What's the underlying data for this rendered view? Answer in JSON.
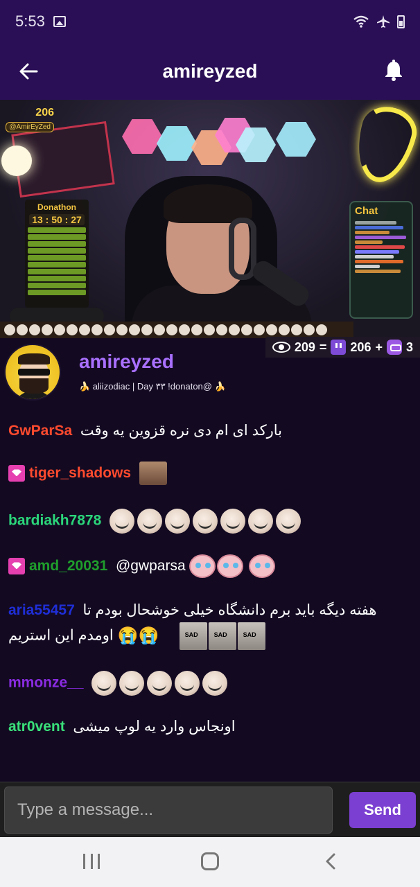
{
  "status_bar": {
    "time": "5:53"
  },
  "app_bar": {
    "title": "amireyzed"
  },
  "stream": {
    "overlay_count": "206",
    "overlay_handle": "@AmirEyZed",
    "donathon_title": "Donathon",
    "donathon_timer": "13 : 50 : 27",
    "chat_panel_title": "Chat"
  },
  "viewer_stats": {
    "views": "209",
    "eq": "=",
    "twitch": "206",
    "plus": "+",
    "kick": "3"
  },
  "profile": {
    "name": "amireyzed",
    "status": "🍌 aliizodiac | Day ۳۳ !donaton@ 🍌"
  },
  "chat": {
    "messages": [
      {
        "user": "GwParSa",
        "color": "#ff4a2e",
        "text": "بارکد ای ام دی نره قزوین یه وقت"
      },
      {
        "user": "tiger_shadows",
        "color": "#ff4a2e"
      },
      {
        "user": "bardiakh7878",
        "color": "#2bd67a"
      },
      {
        "user": "amd_20031",
        "color": "#1f9d2c",
        "text": "@gwparsa"
      },
      {
        "user": "aria55457",
        "color": "#1f2ed6",
        "text": "هفته دیگه باید برم دانشگاه خیلی خوشحال بودم تا",
        "text2": "اومدم این استریم"
      },
      {
        "user": "mmonze__",
        "color": "#8a2be2"
      },
      {
        "user": "atr0vent",
        "color": "#3ae07a",
        "text": "اونجاس وارد یه لوپ میشی"
      }
    ]
  },
  "input": {
    "placeholder": "Type a message...",
    "send_label": "Send"
  },
  "colors": {
    "primary": "#2a0f56",
    "accent": "#7b3fd1",
    "name_purple": "#a970ff",
    "background": "#130a22"
  },
  "icons": [
    "gallery-icon",
    "wifi-icon",
    "airplane-icon",
    "battery-icon",
    "back-arrow-icon",
    "bell-icon",
    "eye-icon",
    "twitch-icon",
    "kick-icon",
    "subscriber-badge-icon"
  ]
}
